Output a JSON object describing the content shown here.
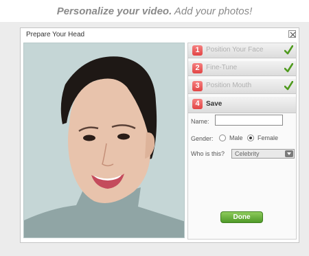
{
  "promo": {
    "headline_bold": "Personalize your video.",
    "headline_rest": "Add your photos!"
  },
  "dialog": {
    "title": "Prepare Your Head"
  },
  "steps": [
    {
      "number": "1",
      "label": "Position Your Face",
      "completed": true
    },
    {
      "number": "2",
      "label": "Fine-Tune",
      "completed": true
    },
    {
      "number": "3",
      "label": "Position Mouth",
      "completed": true
    },
    {
      "number": "4",
      "label": "Save",
      "completed": false,
      "active": true
    }
  ],
  "form": {
    "name_label": "Name:",
    "name_value": "",
    "gender_label": "Gender:",
    "gender_options": [
      "Male",
      "Female"
    ],
    "gender_selected": "Female",
    "who_label": "Who is this?",
    "who_value": "Celebrity"
  },
  "done_label": "Done",
  "colors": {
    "step_badge": "#e24444",
    "check": "#4f9a1e",
    "done_button": "#5fa834",
    "photo_background": "#c5d6d6"
  }
}
